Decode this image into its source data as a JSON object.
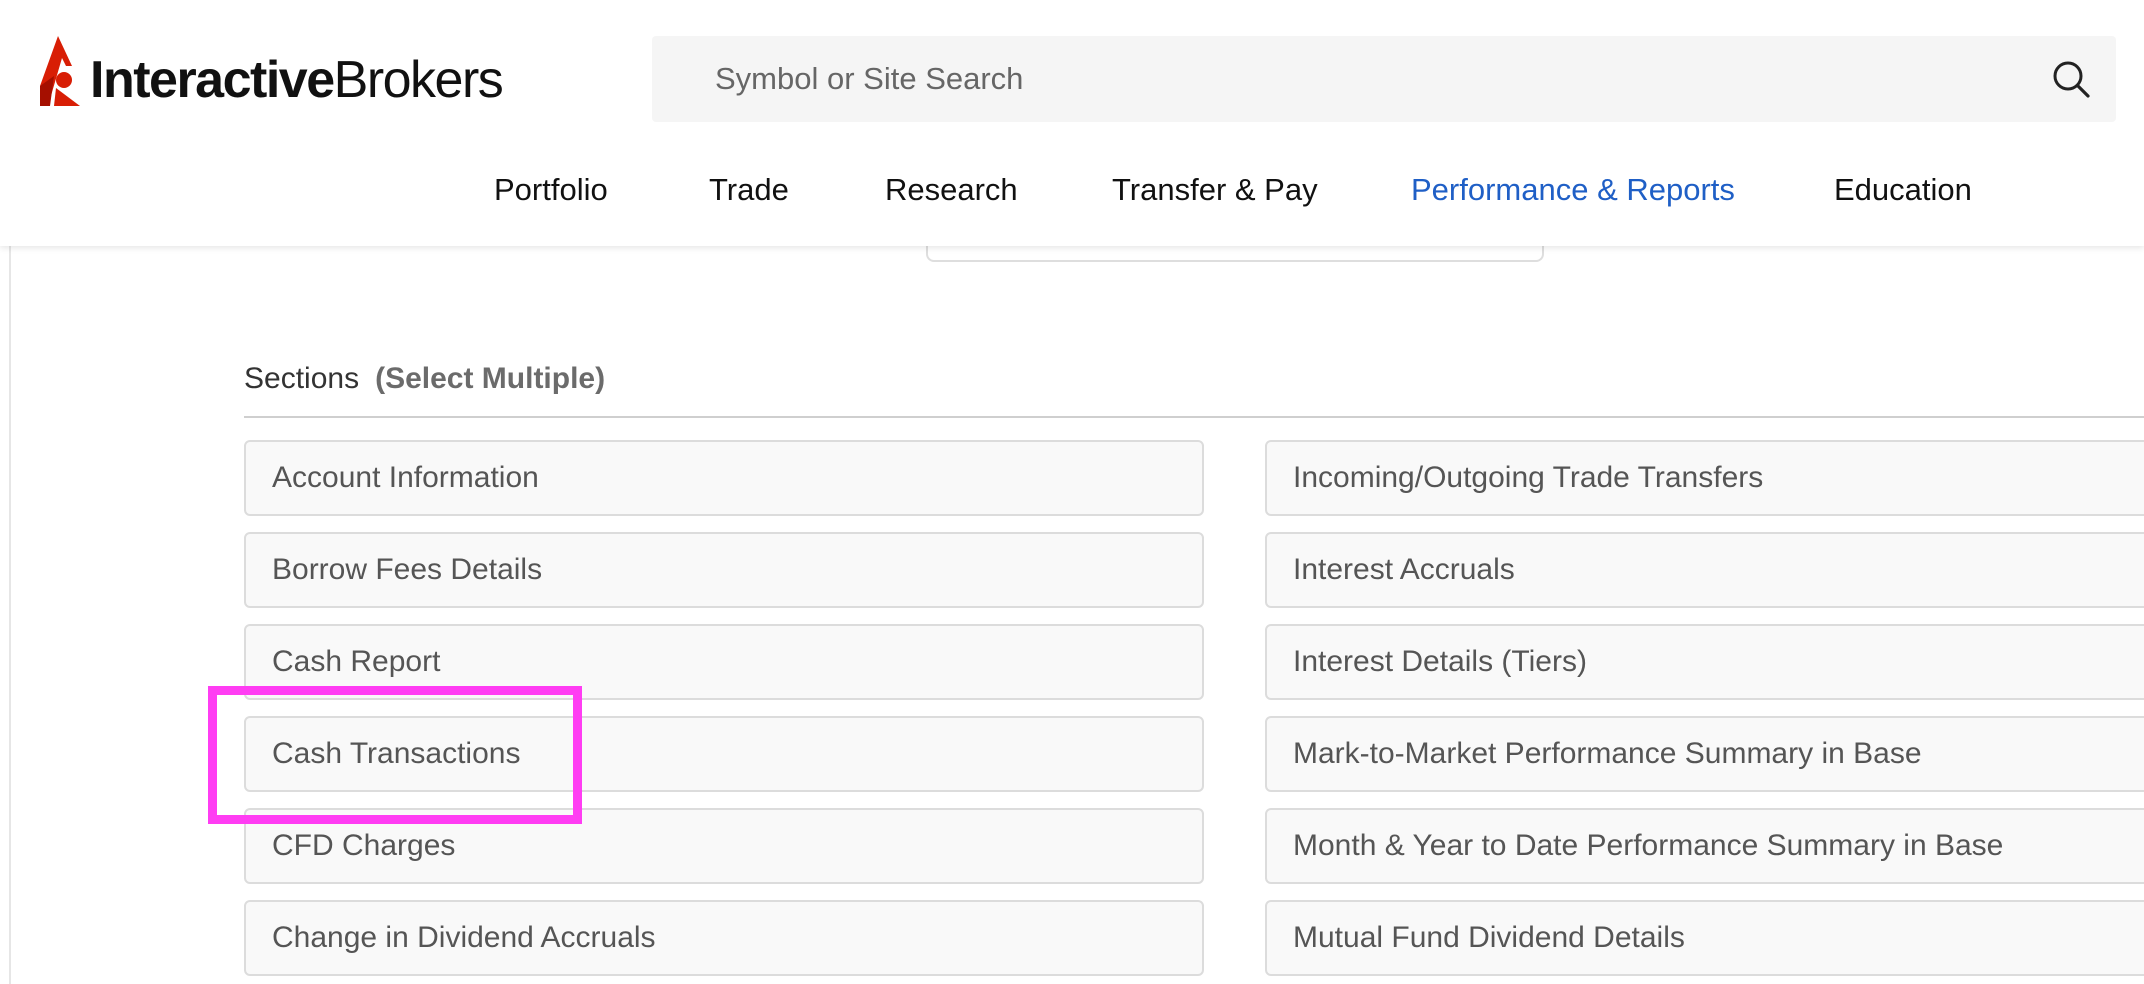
{
  "header": {
    "logo": {
      "bold": "Interactive",
      "light": "Brokers",
      "brand_color": "#d81e05"
    },
    "search": {
      "placeholder": "Symbol or Site Search",
      "value": ""
    },
    "nav": [
      {
        "label": "Portfolio",
        "active": false
      },
      {
        "label": "Trade",
        "active": false
      },
      {
        "label": "Research",
        "active": false
      },
      {
        "label": "Transfer & Pay",
        "active": false
      },
      {
        "label": "Performance & Reports",
        "active": true
      },
      {
        "label": "Education",
        "active": false
      }
    ],
    "active_color": "#1f5fc6"
  },
  "sections": {
    "title": "Sections",
    "subtitle": "(Select Multiple)",
    "left": [
      "Account Information",
      "Borrow Fees Details",
      "Cash Report",
      "Cash Transactions",
      "CFD Charges",
      "Change in Dividend Accruals"
    ],
    "right": [
      "Incoming/Outgoing Trade Transfers",
      "Interest Accruals",
      "Interest Details (Tiers)",
      "Mark-to-Market Performance Summary in Base",
      "Month & Year to Date Performance Summary in Base",
      "Mutual Fund Dividend Details"
    ],
    "highlighted": "Cash Transactions",
    "highlight_color": "#ff3df3"
  }
}
